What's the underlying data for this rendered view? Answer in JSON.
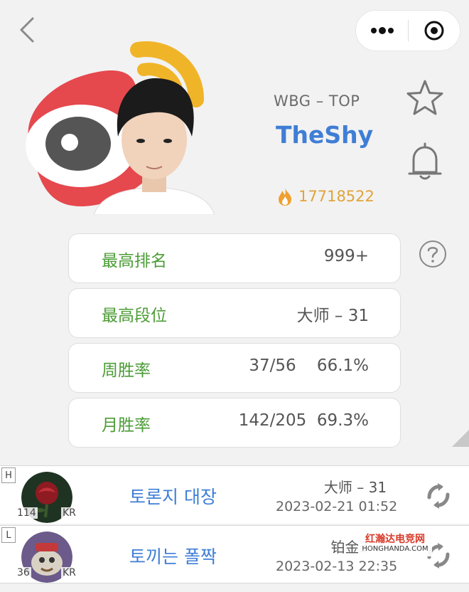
{
  "player": {
    "team_role": "WBG – TOP",
    "name": "TheShy",
    "heat": "17718522"
  },
  "icons": {
    "back": "back-chevron-icon",
    "more": "more-dots-icon",
    "close": "close-circle-icon",
    "star": "star-outline-icon",
    "bell": "bell-outline-icon",
    "help": "question-circle-icon",
    "fire": "fire-icon",
    "refresh": "refresh-icon"
  },
  "stats": [
    {
      "label": "最高排名",
      "value": "999+"
    },
    {
      "label": "最高段位",
      "value": "大师 – 31"
    },
    {
      "label": "周胜率",
      "value": "37/56    66.1%"
    },
    {
      "label": "月胜率",
      "value": "142/205  69.3%"
    }
  ],
  "matches": [
    {
      "mode": "H",
      "level": "114",
      "region": "KR",
      "champion_name": "토론지 대장",
      "rank": "大师 – 31",
      "time": "2023-02-21 01:52"
    },
    {
      "mode": "L",
      "level": "36",
      "region": "KR",
      "champion_name": "토끼는 폴짝",
      "rank": "铂金3 –",
      "time": "2023-02-13 22:35"
    }
  ],
  "watermark": {
    "line1": "红瀚达电竞网",
    "line2": "HONGHANDA.COM"
  },
  "colors": {
    "name_blue": "#3f7ed6",
    "label_green": "#4b9c36",
    "heat_orange": "#e0a33a",
    "weibo_red": "#e5484d",
    "weibo_yellow": "#f0b429"
  }
}
